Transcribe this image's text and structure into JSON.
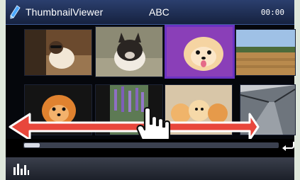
{
  "header": {
    "app_title": "ThumbnailViewer",
    "source_title": "ABC",
    "clock": "00:00",
    "app_icon": "pencil-icon"
  },
  "thumbnails": [
    {
      "row": 1,
      "subject": "dog with sunglasses",
      "selected": false
    },
    {
      "row": 1,
      "subject": "french bulldog",
      "selected": false
    },
    {
      "row": 1,
      "subject": "pomeranian",
      "selected": true
    },
    {
      "row": 1,
      "subject": "field landscape",
      "selected": false
    },
    {
      "row": 2,
      "subject": "orange pomeranian",
      "selected": false
    },
    {
      "row": 2,
      "subject": "lavender field",
      "selected": false
    },
    {
      "row": 2,
      "subject": "group of pomeranians",
      "selected": false
    },
    {
      "row": 2,
      "subject": "bridge",
      "selected": false
    }
  ],
  "gesture": {
    "type": "swipe-horizontal",
    "icon": "hand-pointer-icon",
    "arrow_color": "#e8473c"
  },
  "scrollbar": {
    "position_fraction": 0.06
  },
  "controls": {
    "back_icon": "return-arrow-icon",
    "eq_icon": "equalizer-icon"
  },
  "colors": {
    "selected_border": "#6a33c2",
    "header": "#2b3f6e",
    "frame": "#dfe8dc"
  }
}
